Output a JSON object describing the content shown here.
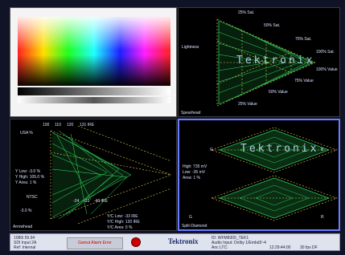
{
  "picture": {
    "label": ""
  },
  "spearhead": {
    "title": "Spearhead",
    "watermark": "Tektronix",
    "labels": {
      "sat25": "25% Sat.",
      "sat50": "50% Sat.",
      "sat75": "75% Sat.",
      "sat100": "100% Sat.",
      "val100": "100% Value",
      "val75": "75% Value",
      "val50": "50% Value",
      "val25": "25% Value",
      "lightness": "Lightness"
    }
  },
  "arrowhead": {
    "title": "Arrowhead",
    "top_ticks": [
      "100",
      "110",
      "120",
      "131 IRE"
    ],
    "bottom_ticks": [
      "-24",
      "-33",
      "-40 IRE"
    ],
    "usa": "USA %",
    "y_low": "Y Low: -3.0 %",
    "y_high": "Y High: 105.0 %",
    "y_area": "Y Area:  1 %",
    "ntsc": "NTSC",
    "pct": "-3.0 %",
    "yc_low": "Y/C Low: -33 IRE",
    "yc_high": "Y/C High: 120 IRE",
    "yc_area": "Y/C Area:  0 %"
  },
  "diamond": {
    "title": "Split-Diamond",
    "watermark": "Tektronix",
    "g": "G",
    "b": "B",
    "r": "R",
    "high": "High: 735 mV",
    "low": "Low: -35 mV",
    "area": "Area:  1 %"
  },
  "status": {
    "format": "1080i 59.94",
    "sdi": "SDI Input 2A",
    "ref": "Ref: Internal",
    "alarm": "Gamut Alarm Error",
    "brand": "Tektronix",
    "id": "ID: WFM8300_TEK1",
    "audio": "Audio Input: Dolby 1/Embd3~4",
    "anc": "Anc LTC:",
    "timecode": "12:29:44:00",
    "fps": "30 fps DF"
  },
  "colors": {
    "trace": "#39ff6a",
    "graticule": "#e0d050",
    "panel_border": "#6a7cff",
    "frame": "#101426"
  }
}
